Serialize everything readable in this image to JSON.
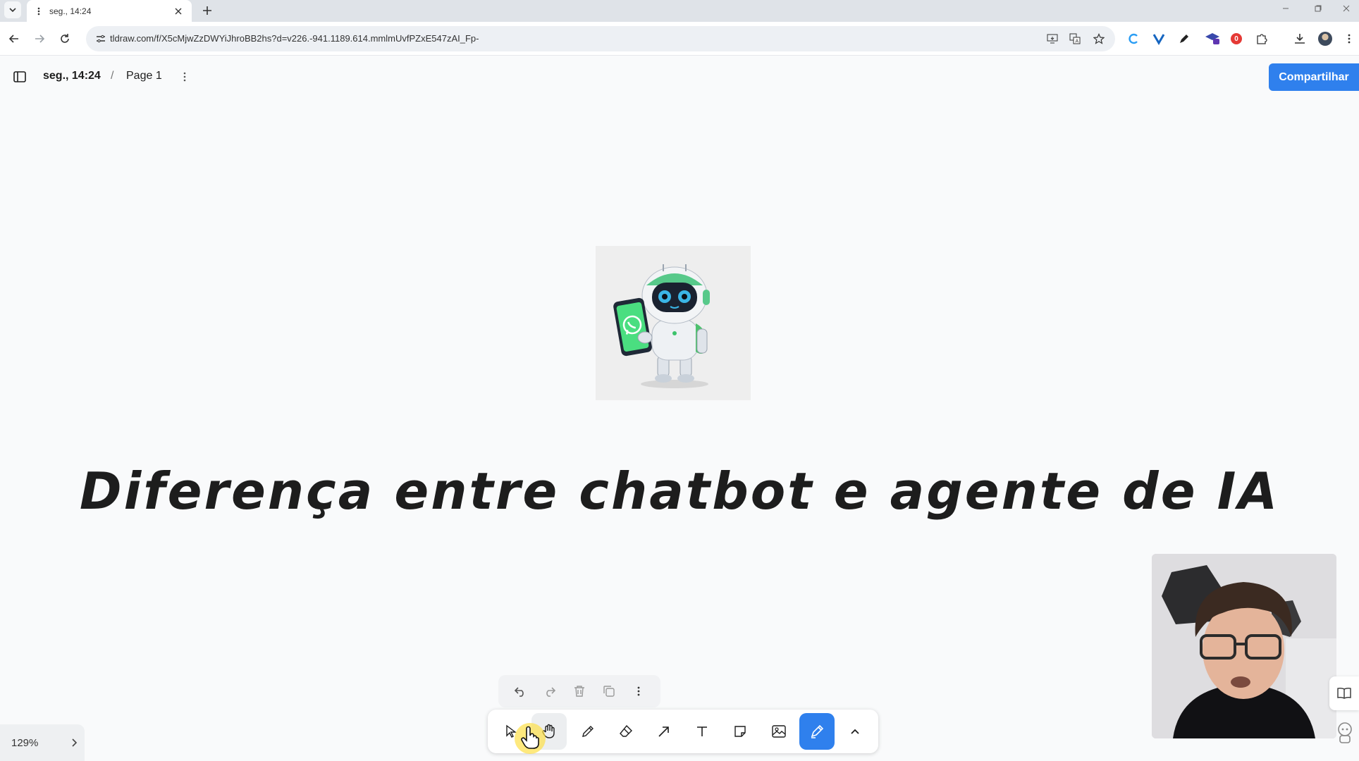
{
  "browser": {
    "tab_title": "seg., 14:24",
    "url": "tldraw.com/f/X5cMjwZzDWYiJhroBB2hs?d=v226.-941.1189.614.mmlmUvfPZxE547zAI_Fp-",
    "nav_icons": [
      "back-icon",
      "forward-icon",
      "reload-icon"
    ],
    "extension_badge_count": "0"
  },
  "header": {
    "doc_name": "seg., 14:24",
    "separator": "/",
    "page_name": "Page 1",
    "share_label": "Compartilhar",
    "accent_color": "#2f80ed"
  },
  "canvas": {
    "headline": "Diferença entre chatbot e agente de IA",
    "image": {
      "subject": "robot holding phone with chat app",
      "icons": [
        "robot-image",
        "phone-icon",
        "chat-logo-icon"
      ]
    },
    "webcam_overlay": "presenter video"
  },
  "quick_actions": [
    "undo-icon",
    "redo-icon",
    "trash-icon",
    "duplicate-icon",
    "more-vertical-icon"
  ],
  "toolbar": {
    "tools": [
      "select",
      "hand",
      "draw",
      "eraser",
      "arrow",
      "text",
      "note",
      "media",
      "highlight",
      "more"
    ],
    "active_tool": "highlight"
  },
  "zoom": {
    "label": "129%"
  }
}
